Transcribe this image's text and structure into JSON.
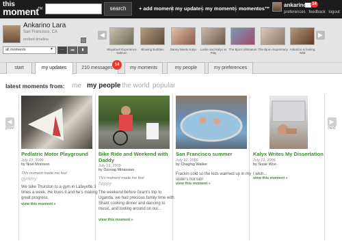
{
  "brand": {
    "line1": "this",
    "line2": "moment",
    "tm": "TM"
  },
  "search": {
    "placeholder": "",
    "button": "search"
  },
  "nav": {
    "add": "+ add moment",
    "updates": "my updates",
    "moments": "my moments",
    "momentos": "momentos™"
  },
  "user": {
    "name": "ankarino",
    "mail_count": "14",
    "links": [
      "preferences",
      "feedback",
      "logout"
    ]
  },
  "profile": {
    "name": "Ankarino Lara",
    "location": "San Francisco, CA",
    "embed": "embed timeline",
    "select": "all moments"
  },
  "thumbs": [
    {
      "caption": "Mayahuel Experience Salmon",
      "colors": [
        "#c9c2a8",
        "#6a6a5a"
      ]
    },
    {
      "caption": "Blowing Bubbles",
      "colors": [
        "#b79a7a",
        "#5a4a3a"
      ]
    },
    {
      "caption": "Danny Meets Kalyx",
      "colors": [
        "#e2c0a8",
        "#8a5a48"
      ]
    },
    {
      "caption": "Leslie and Kalyx at Play",
      "colors": [
        "#c8b8a8",
        "#6a5a4a"
      ]
    },
    {
      "caption": "The Bjorn Ultimatum",
      "colors": [
        "#7a9ab8",
        "#a04a6a"
      ]
    },
    {
      "caption": "The Bjorn Supremacy",
      "colors": [
        "#d8c8b8",
        "#8a7868"
      ]
    },
    {
      "caption": "Ankarino is feeling Wild",
      "colors": [
        "#b89878",
        "#5a3a28"
      ]
    }
  ],
  "tabs": [
    "start",
    "my updates",
    "210 messages",
    "my moments",
    "my people",
    "my preferences"
  ],
  "tab_badge": "14",
  "feed": {
    "label": "latest moments from:",
    "filters": [
      "me",
      "my people",
      "the world",
      "popular"
    ],
    "prev": "prev",
    "next": "next"
  },
  "cards": [
    {
      "title": "Pedlatric Motor Playground",
      "date": "July 23, 2009",
      "by": "by Noel Morrison",
      "feel": "This moment made me feel",
      "mood": "gymmy",
      "body": "We take Thurston to a gym in Lafayette 3 times a week. He loves it and he's making great progress.",
      "link": "view this moment »"
    },
    {
      "title": "Bike Ride and Weekend with Daddy",
      "date": "July 19, 2009",
      "by": "by Dzovag Minassian",
      "feel": "This moment made me feel",
      "mood": "happy",
      "body": "The weekend before Grant's trip to Uganda, we had precious family time with Shant cooking dinner and dancing to music, and tooling around on our...",
      "link": "view this moment »"
    },
    {
      "title": "San Francisco summer",
      "date": "July 22, 2009",
      "by": "by Chaghig Walker",
      "feel": "",
      "mood": "",
      "body": "Frackin cold so the kids warmed up in my sister's hot tub!",
      "link": "view this moment »"
    },
    {
      "title": "Kalyx Writes My Dissertation",
      "date": "July 22, 2009",
      "by": "by Susie Woo",
      "feel": "",
      "mood": "",
      "body": "I wish...",
      "link": "view this moment »"
    }
  ],
  "colors": {
    "topbar": "#1c1c1c",
    "accent_green": "#3a8f2e",
    "badge_red": "#e23b2e"
  }
}
